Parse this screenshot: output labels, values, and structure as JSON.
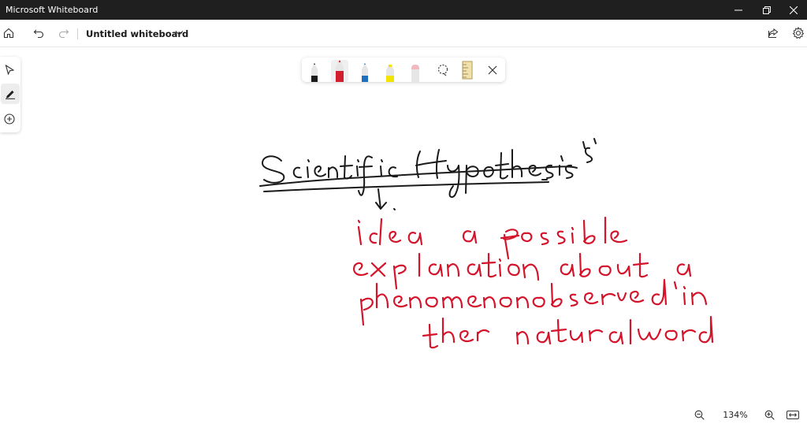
{
  "window": {
    "title": "Microsoft Whiteboard"
  },
  "header": {
    "document_title": "Untitled whiteboard"
  },
  "pen_toolbar": {
    "pens": [
      {
        "name": "black-pen",
        "color": "#1a1a1a"
      },
      {
        "name": "red-pen",
        "color": "#d11f2f",
        "selected": true
      },
      {
        "name": "blue-pen",
        "color": "#1f6fc0"
      },
      {
        "name": "yellow-highlighter",
        "color": "#f2e300"
      },
      {
        "name": "eraser",
        "color": "#f3b8be"
      }
    ],
    "tools": [
      "lasso-select-icon",
      "ruler-icon",
      "close-icon"
    ]
  },
  "canvas": {
    "ink_color_black": "#1a1a1a",
    "ink_color_red": "#d4142a",
    "handwritten_lines": [
      "Scientific Hypothesis",
      "idea a possible",
      "explanation about a",
      "phenomenon observed in",
      "the natural world"
    ]
  },
  "zoom": {
    "level": "134%"
  }
}
